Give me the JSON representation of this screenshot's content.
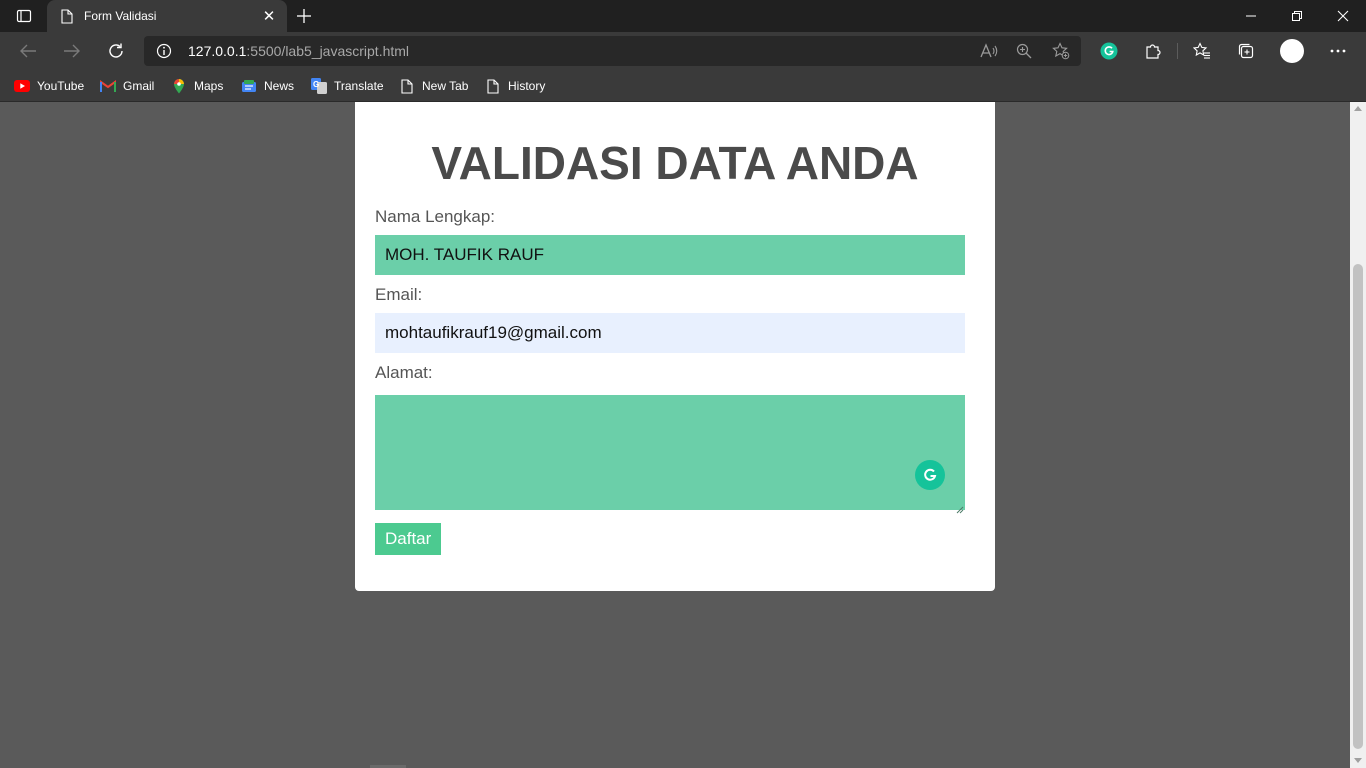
{
  "browser": {
    "tab_title": "Form Validasi",
    "url_host": "127.0.0.1",
    "url_rest": ":5500/lab5_javascript.html"
  },
  "bookmarks": [
    {
      "label": "YouTube",
      "icon": "youtube-icon"
    },
    {
      "label": "Gmail",
      "icon": "gmail-icon"
    },
    {
      "label": "Maps",
      "icon": "maps-icon"
    },
    {
      "label": "News",
      "icon": "news-icon"
    },
    {
      "label": "Translate",
      "icon": "translate-icon"
    },
    {
      "label": "New Tab",
      "icon": "page-icon"
    },
    {
      "label": "History",
      "icon": "page-icon"
    }
  ],
  "form": {
    "title": "VALIDASI DATA ANDA",
    "name_label": "Nama Lengkap:",
    "name_value": "MOH. TAUFIK RAUF",
    "email_label": "Email:",
    "email_value": "mohtaufikrauf19@gmail.com",
    "address_label": "Alamat:",
    "address_value": "",
    "submit_label": "Daftar"
  },
  "colors": {
    "field_valid": "#6bcfa9",
    "field_autofill": "#e8f0fe",
    "button": "#4cca90",
    "page_bg": "#5a5a5a"
  }
}
